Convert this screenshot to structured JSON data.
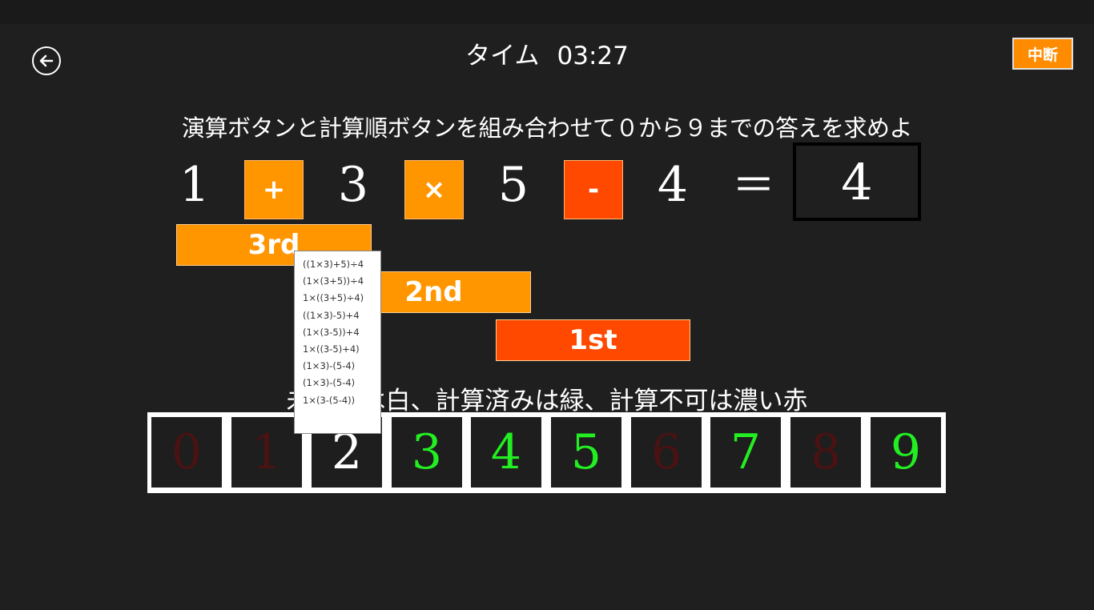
{
  "header": {
    "timer_label": "タイム",
    "timer_value": "03:27",
    "suspend_label": "中断",
    "back_icon": "back-arrow-icon"
  },
  "instruction": "演算ボタンと計算順ボタンを組み合わせて０から９までの答えを求めよ",
  "equation": {
    "numbers": [
      "1",
      "3",
      "5",
      "4"
    ],
    "operators": [
      {
        "symbol": "+",
        "color": "#ff9600"
      },
      {
        "symbol": "×",
        "color": "#ff9600"
      },
      {
        "symbol": "-",
        "color": "#ff4800"
      }
    ],
    "equals": "＝",
    "answer": "4"
  },
  "order_buttons": [
    {
      "label": "3rd",
      "color": "#ff9600"
    },
    {
      "label": "2nd",
      "color": "#ff9600"
    },
    {
      "label": "1st",
      "color": "#ff4800"
    }
  ],
  "legend": "未計算は白、計算済みは緑、計算不可は濃い赤",
  "digits": [
    {
      "value": "0",
      "state": "impossible",
      "color": "#4a1212"
    },
    {
      "value": "1",
      "state": "impossible",
      "color": "#4a1212"
    },
    {
      "value": "2",
      "state": "uncalculated",
      "color": "#ffffff"
    },
    {
      "value": "3",
      "state": "calculated",
      "color": "#22ee22"
    },
    {
      "value": "4",
      "state": "calculated",
      "color": "#22ee22"
    },
    {
      "value": "5",
      "state": "calculated",
      "color": "#22ee22"
    },
    {
      "value": "6",
      "state": "impossible",
      "color": "#4a1212"
    },
    {
      "value": "7",
      "state": "calculated",
      "color": "#22ee22"
    },
    {
      "value": "8",
      "state": "impossible",
      "color": "#4a1212"
    },
    {
      "value": "9",
      "state": "calculated",
      "color": "#22ee22"
    }
  ],
  "tooltip": {
    "items": [
      "((1×3)+5)÷4",
      "(1×(3+5))÷4",
      "1×((3+5)÷4)",
      "((1×3)-5)+4",
      "(1×(3-5))+4",
      "1×((3-5)+4)",
      "(1×3)-(5-4)",
      "(1×3)-(5-4)",
      "1×(3-(5-4))"
    ]
  }
}
